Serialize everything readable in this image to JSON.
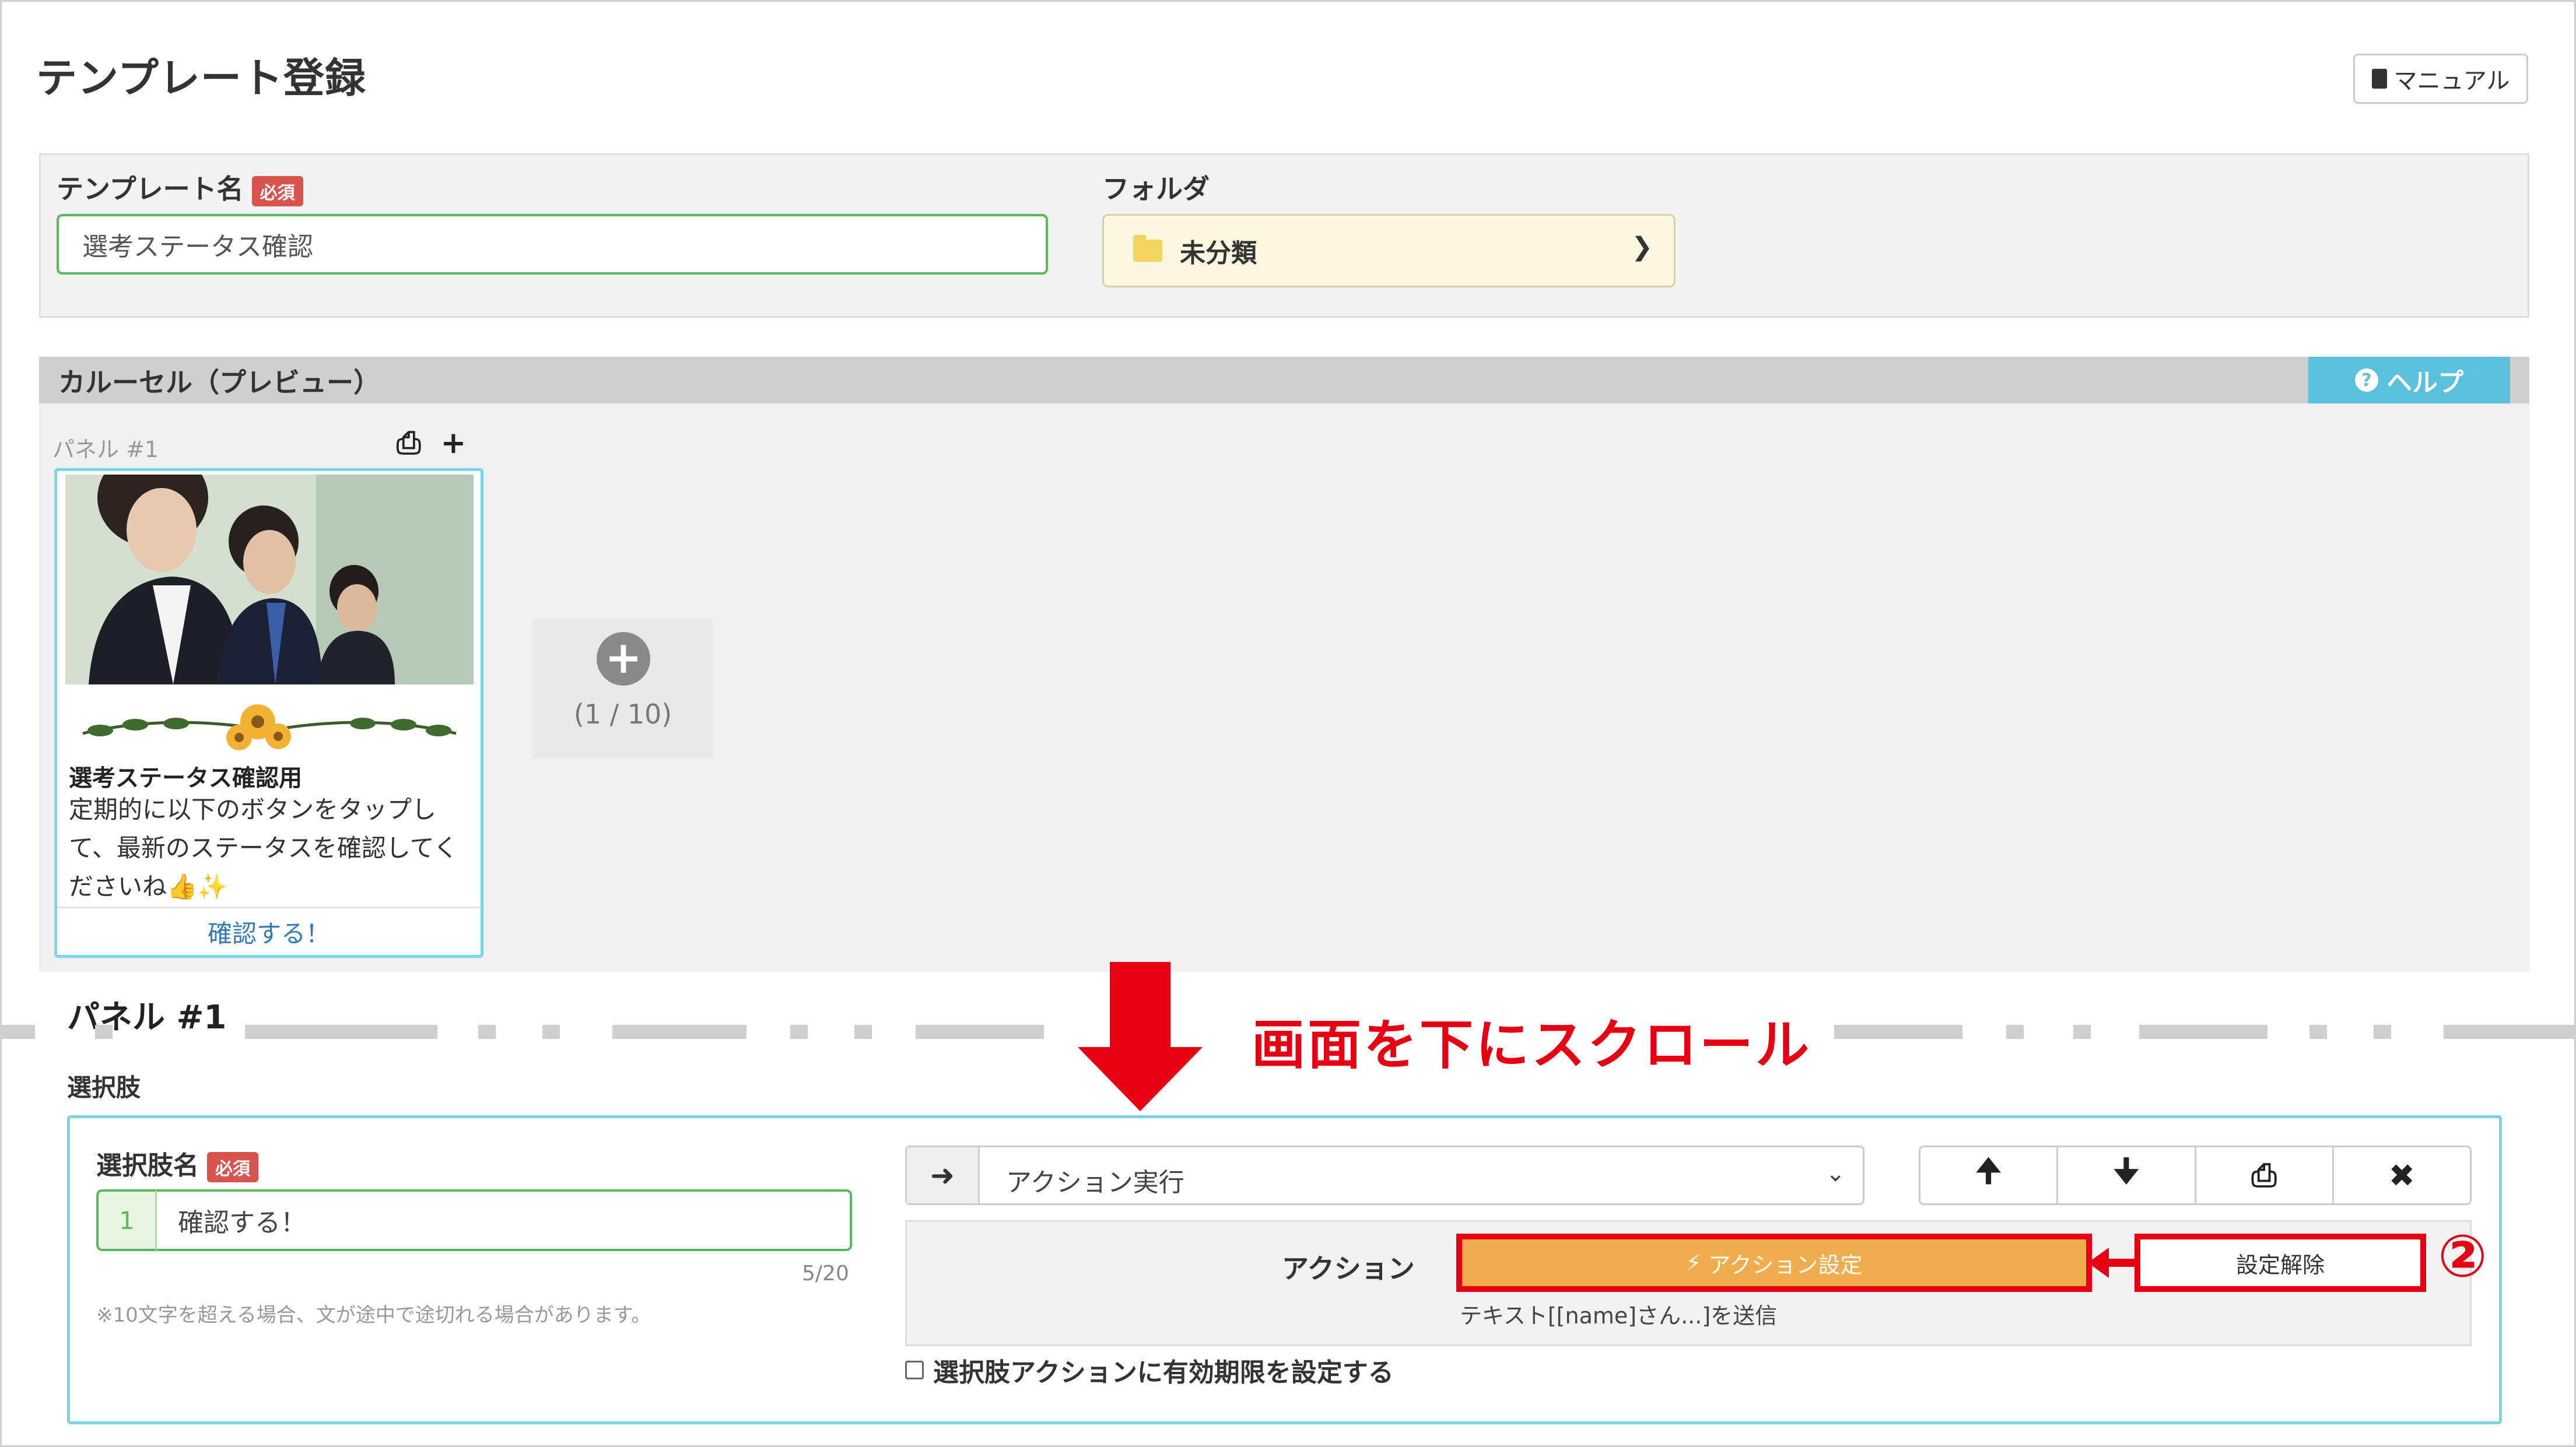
{
  "page": {
    "title": "テンプレート登録",
    "manual_label": "マニュアル"
  },
  "template_form": {
    "name_label": "テンプレート名",
    "required_badge": "必須",
    "name_value": "選考ステータス確認",
    "folder_label": "フォルダ",
    "folder_value": "未分類"
  },
  "carousel": {
    "header": "カルーセル（プレビュー）",
    "help_label": "ヘルプ",
    "panel_label": "パネル #1",
    "card": {
      "title": "選考ステータス確認用",
      "text": "定期的に以下のボタンをタップして、最新のステータスを確認してくださいね👍✨",
      "button": "確認する！"
    },
    "add_count": "(1 / 10)"
  },
  "annotation": {
    "scroll_text": "画面を下にスクロール",
    "step_marker": "②"
  },
  "panel_section": {
    "heading": "パネル #1",
    "choices_label": "選択肢",
    "choice_name_label": "選択肢名",
    "required_badge": "必須",
    "choice_index": "1",
    "choice_value": "確認する！",
    "char_count": "5/20",
    "note": "※10文字を超える場合、文が途中で途切れる場合があります。",
    "action_type": "アクション実行",
    "action_label": "アクション",
    "action_set_button": "アクション設定",
    "action_unset_button": "設定解除",
    "action_summary": "テキスト[[name]さん...]を送信",
    "expiry_label": "選択肢アクションに有効期限を設定する"
  },
  "colors": {
    "accent_red": "#e60012",
    "help_blue": "#5bc0de",
    "action_orange": "#f0ad4e",
    "valid_green": "#5cb85c"
  }
}
